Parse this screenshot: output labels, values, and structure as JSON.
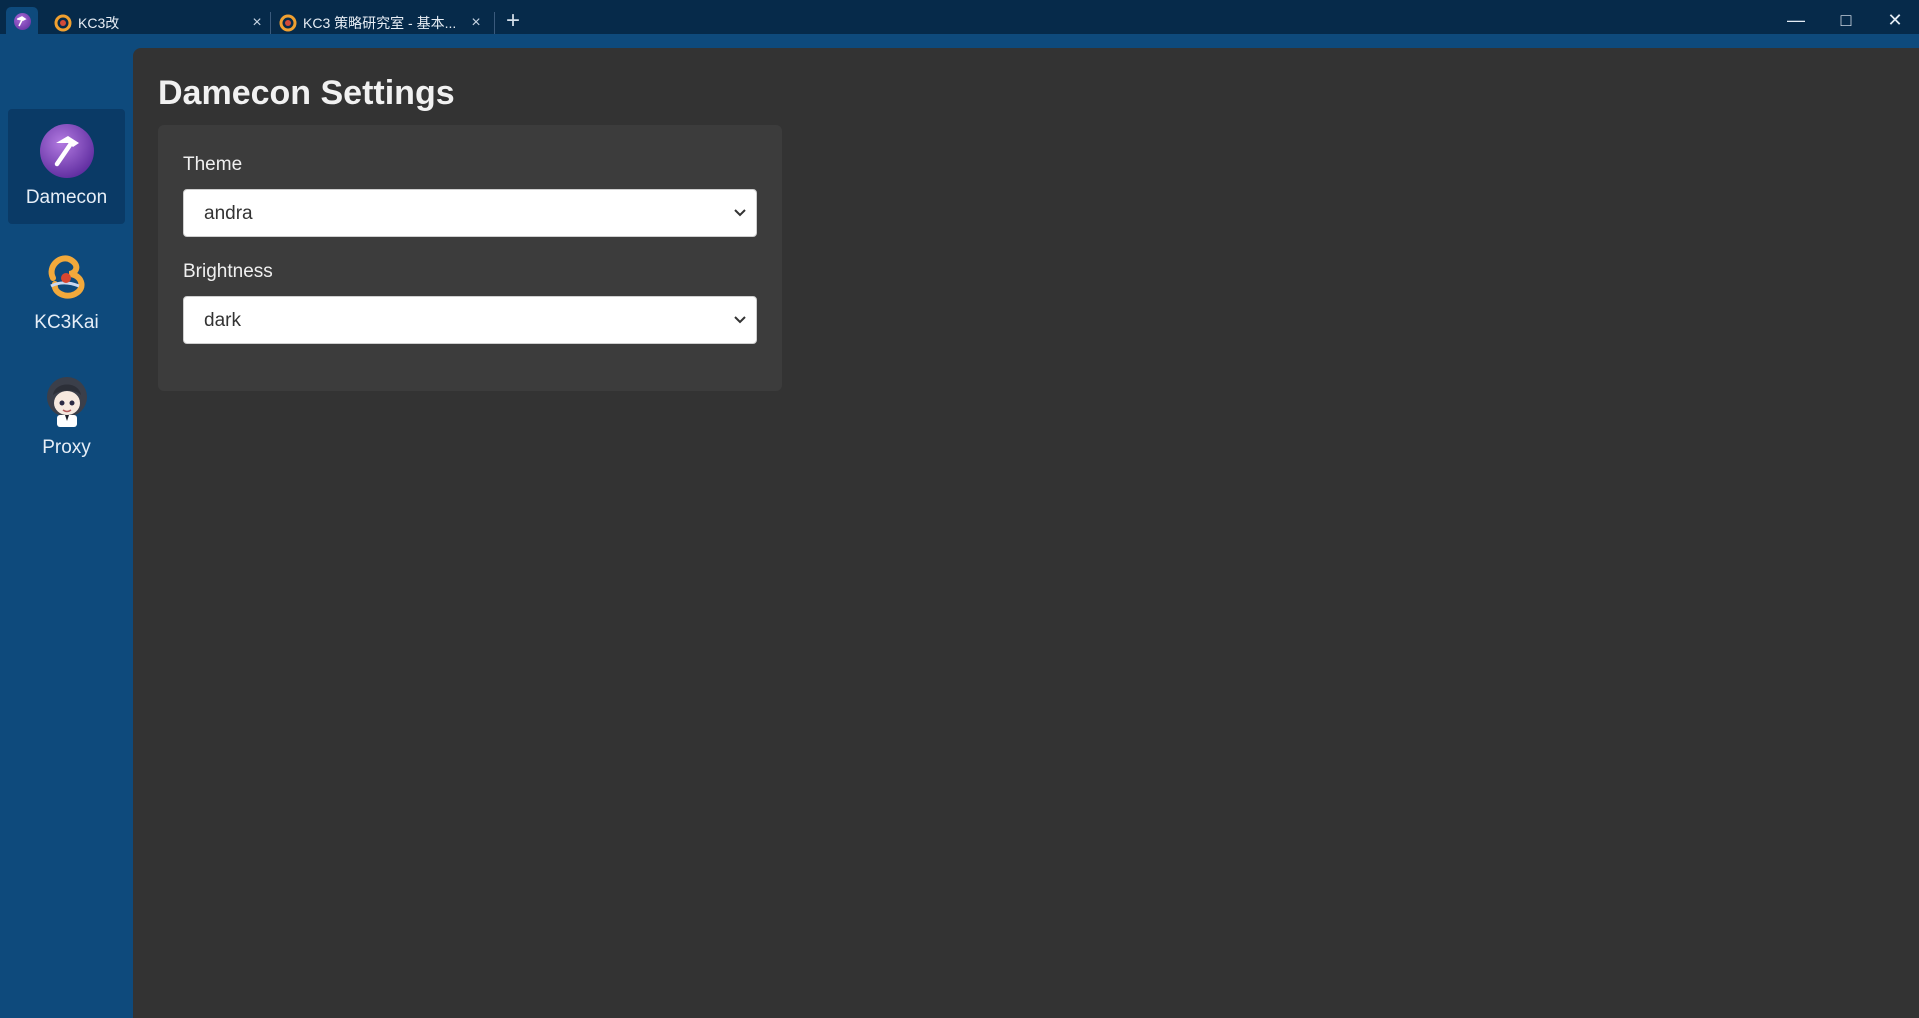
{
  "titlebar": {
    "tabs": [
      {
        "label": "KC3改"
      },
      {
        "label": "KC3 策略研究室 - 基本..."
      }
    ],
    "close_glyph": "×",
    "new_tab_glyph": "+",
    "window_controls": {
      "minimize": "—",
      "maximize": "□",
      "close": "✕"
    }
  },
  "sidebar": {
    "items": [
      {
        "label": "Damecon",
        "icon": "damecon-hammer-icon",
        "active": true
      },
      {
        "label": "KC3Kai",
        "icon": "kc3kai-logo-icon",
        "active": false
      },
      {
        "label": "Proxy",
        "icon": "proxy-avatar-icon",
        "active": false
      }
    ]
  },
  "main": {
    "title": "Damecon Settings",
    "fields": [
      {
        "label": "Theme",
        "value": "andra"
      },
      {
        "label": "Brightness",
        "value": "dark"
      }
    ]
  },
  "colors": {
    "titlebar": "#062a4a",
    "sidebar": "#0e4a7c",
    "main_bg": "#333333",
    "card_bg": "#3c3c3c",
    "accent_purple": "#7b3fb8"
  }
}
